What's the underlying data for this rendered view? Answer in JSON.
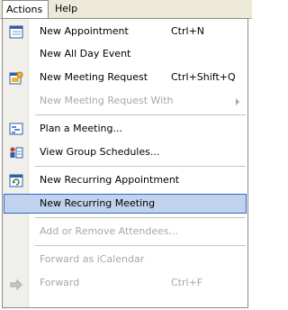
{
  "menubar": {
    "actions_label": "Actions",
    "help_label": "Help"
  },
  "menu": {
    "items": [
      {
        "label": "New Appointment",
        "shortcut": "Ctrl+N",
        "icon": "calendar-icon"
      },
      {
        "label": "New All Day Event"
      },
      {
        "label": "New Meeting Request",
        "shortcut": "Ctrl+Shift+Q",
        "icon": "meeting-request-icon"
      },
      {
        "label": "New Meeting Request With",
        "disabled": true,
        "submenu": true
      },
      {
        "label": "Plan a Meeting...",
        "icon": "plan-meeting-icon"
      },
      {
        "label": "View Group Schedules...",
        "icon": "group-schedule-icon"
      },
      {
        "label": "New Recurring Appointment",
        "icon": "recurring-appointment-icon"
      },
      {
        "label": "New Recurring Meeting",
        "highlighted": true
      },
      {
        "label": "Add or Remove Attendees...",
        "disabled": true
      },
      {
        "label": "Forward as iCalendar",
        "disabled": true
      },
      {
        "label": "Forward",
        "shortcut": "Ctrl+F",
        "disabled": true,
        "icon": "forward-icon"
      }
    ]
  },
  "colors": {
    "menubar_bg": "#ece9d8",
    "highlight_bg": "#c1d2ee",
    "highlight_border": "#316ac5",
    "disabled_text": "#a7a6aa"
  }
}
